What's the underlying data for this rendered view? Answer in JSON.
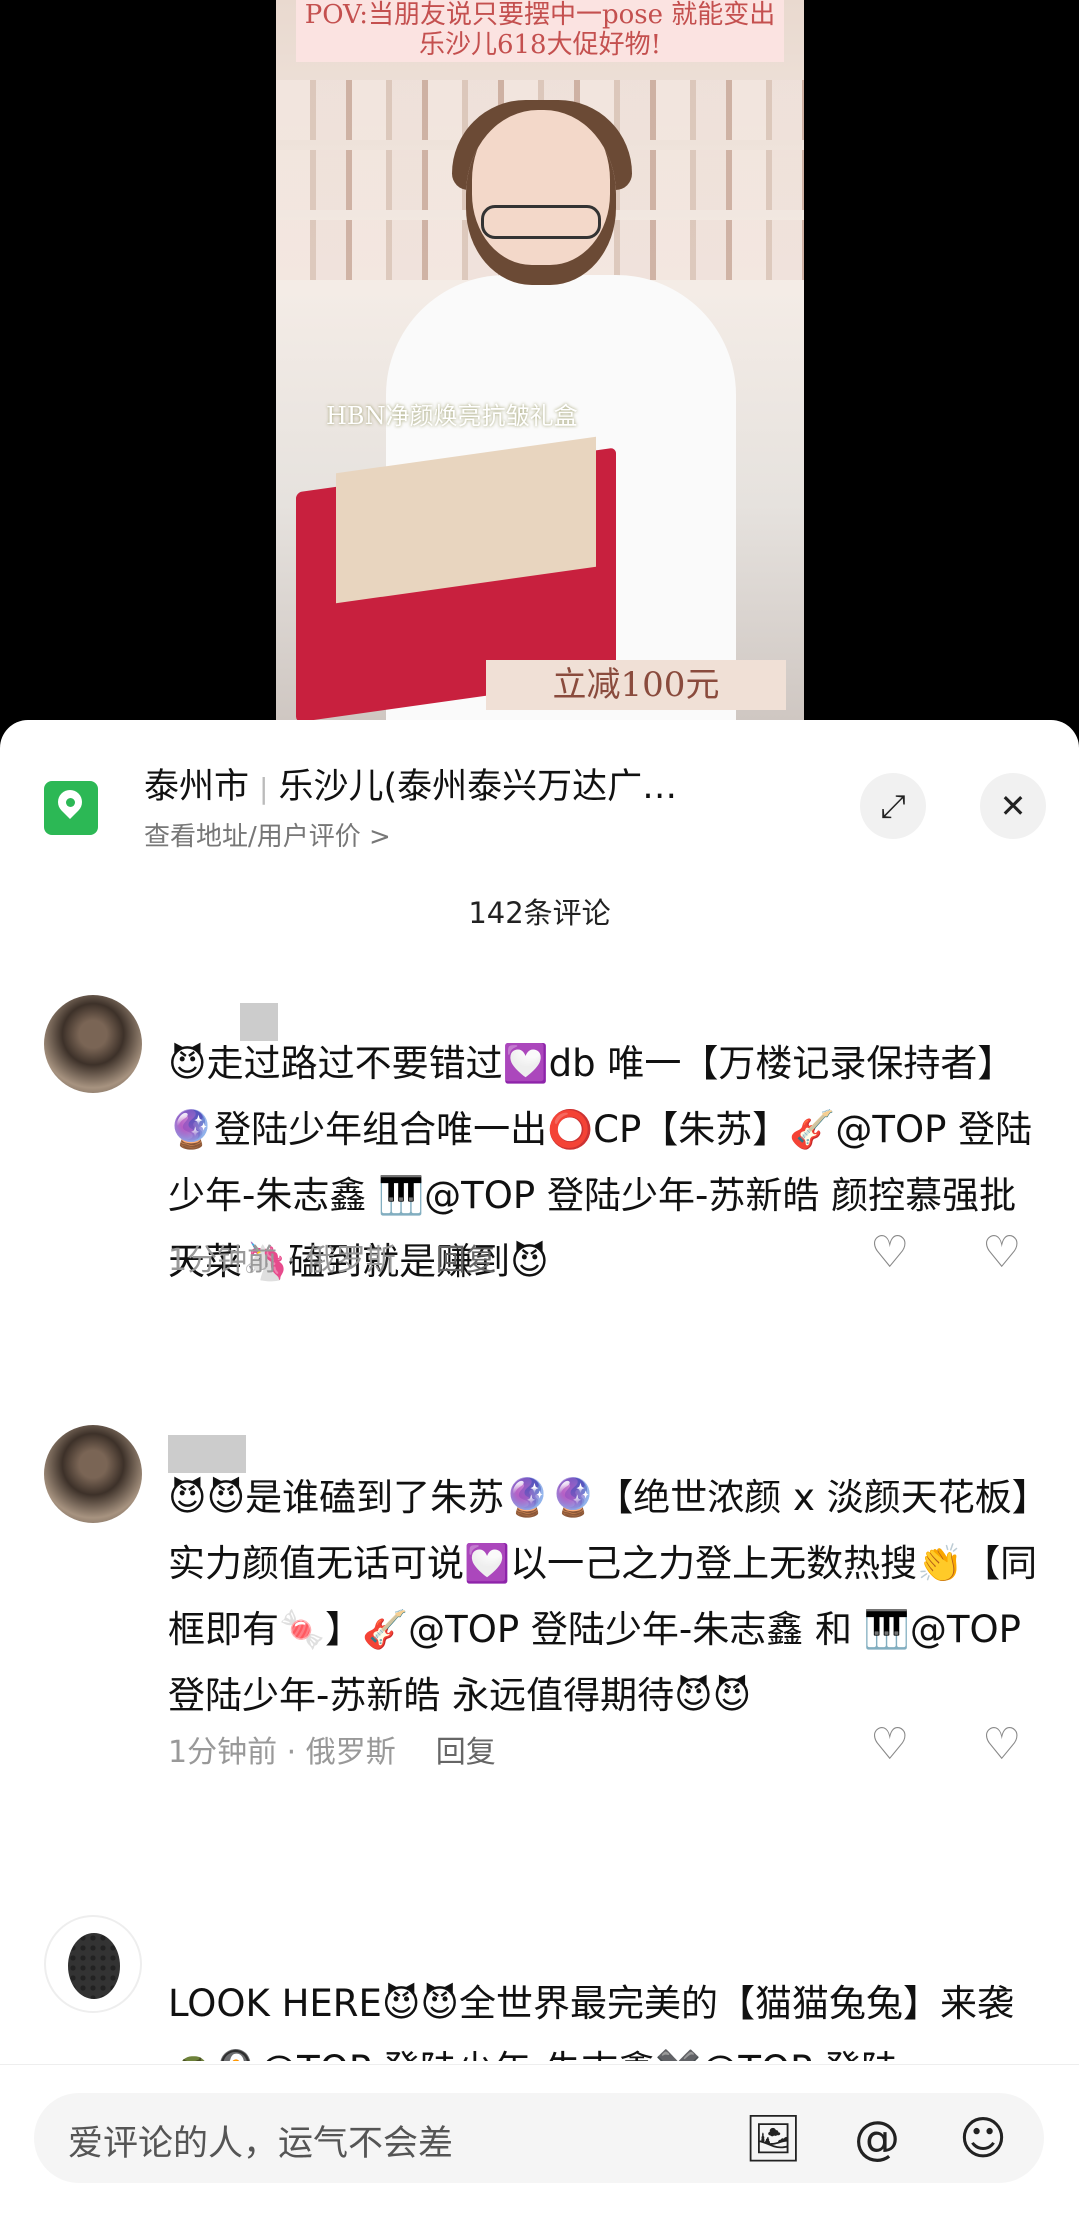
{
  "video": {
    "banner_text": "POV:当朋友说只要摆中一pose 就能变出乐沙儿618大促好物!",
    "product_label": "HBN净颜焕亮抗皱礼盒",
    "price_tag": "立减100元"
  },
  "location": {
    "city": "泰州市",
    "store": "乐沙儿(泰州泰兴万达广…",
    "subtitle": "查看地址/用户评价 >",
    "expand_icon": "⤢",
    "close_icon": "✕"
  },
  "comments_count": "142条评论",
  "comments": [
    {
      "text": "😈走过路过不要错过💟db 唯一【万楼记录保持者】🔮登陆少年组合唯一出⭕CP【朱苏】🎸@TOP 登陆少年-朱志鑫 🎹@TOP 登陆少年-苏新皓 颜控慕强批天菜🦄磕到就是赚到😈",
      "time": "1分钟前",
      "place": "俄罗斯",
      "reply": "回复"
    },
    {
      "text": "😈😈是谁磕到了朱苏🔮🔮【绝世浓颜 x 淡颜天花板】实力颜值无话可说💟以一己之力登上无数热搜👏【同框即有🍬】🎸@TOP 登陆少年-朱志鑫 和 🎹@TOP 登陆少年-苏新皓 永远值得期待😈😈",
      "time": "1分钟前",
      "place": "俄罗斯",
      "reply": "回复"
    },
    {
      "text": "LOOK HERE😈😈全世界最完美的【猫猫兔兔】来袭🐢🍳@TOP 登陆少年-朱志鑫✖️@TOP 登陆"
    }
  ],
  "input": {
    "placeholder": "爱评论的人，运气不会差",
    "image_icon": "🖼",
    "at_icon": "@",
    "emoji_icon": "☺"
  },
  "icons": {
    "like": "♡",
    "dislike": "♡"
  }
}
